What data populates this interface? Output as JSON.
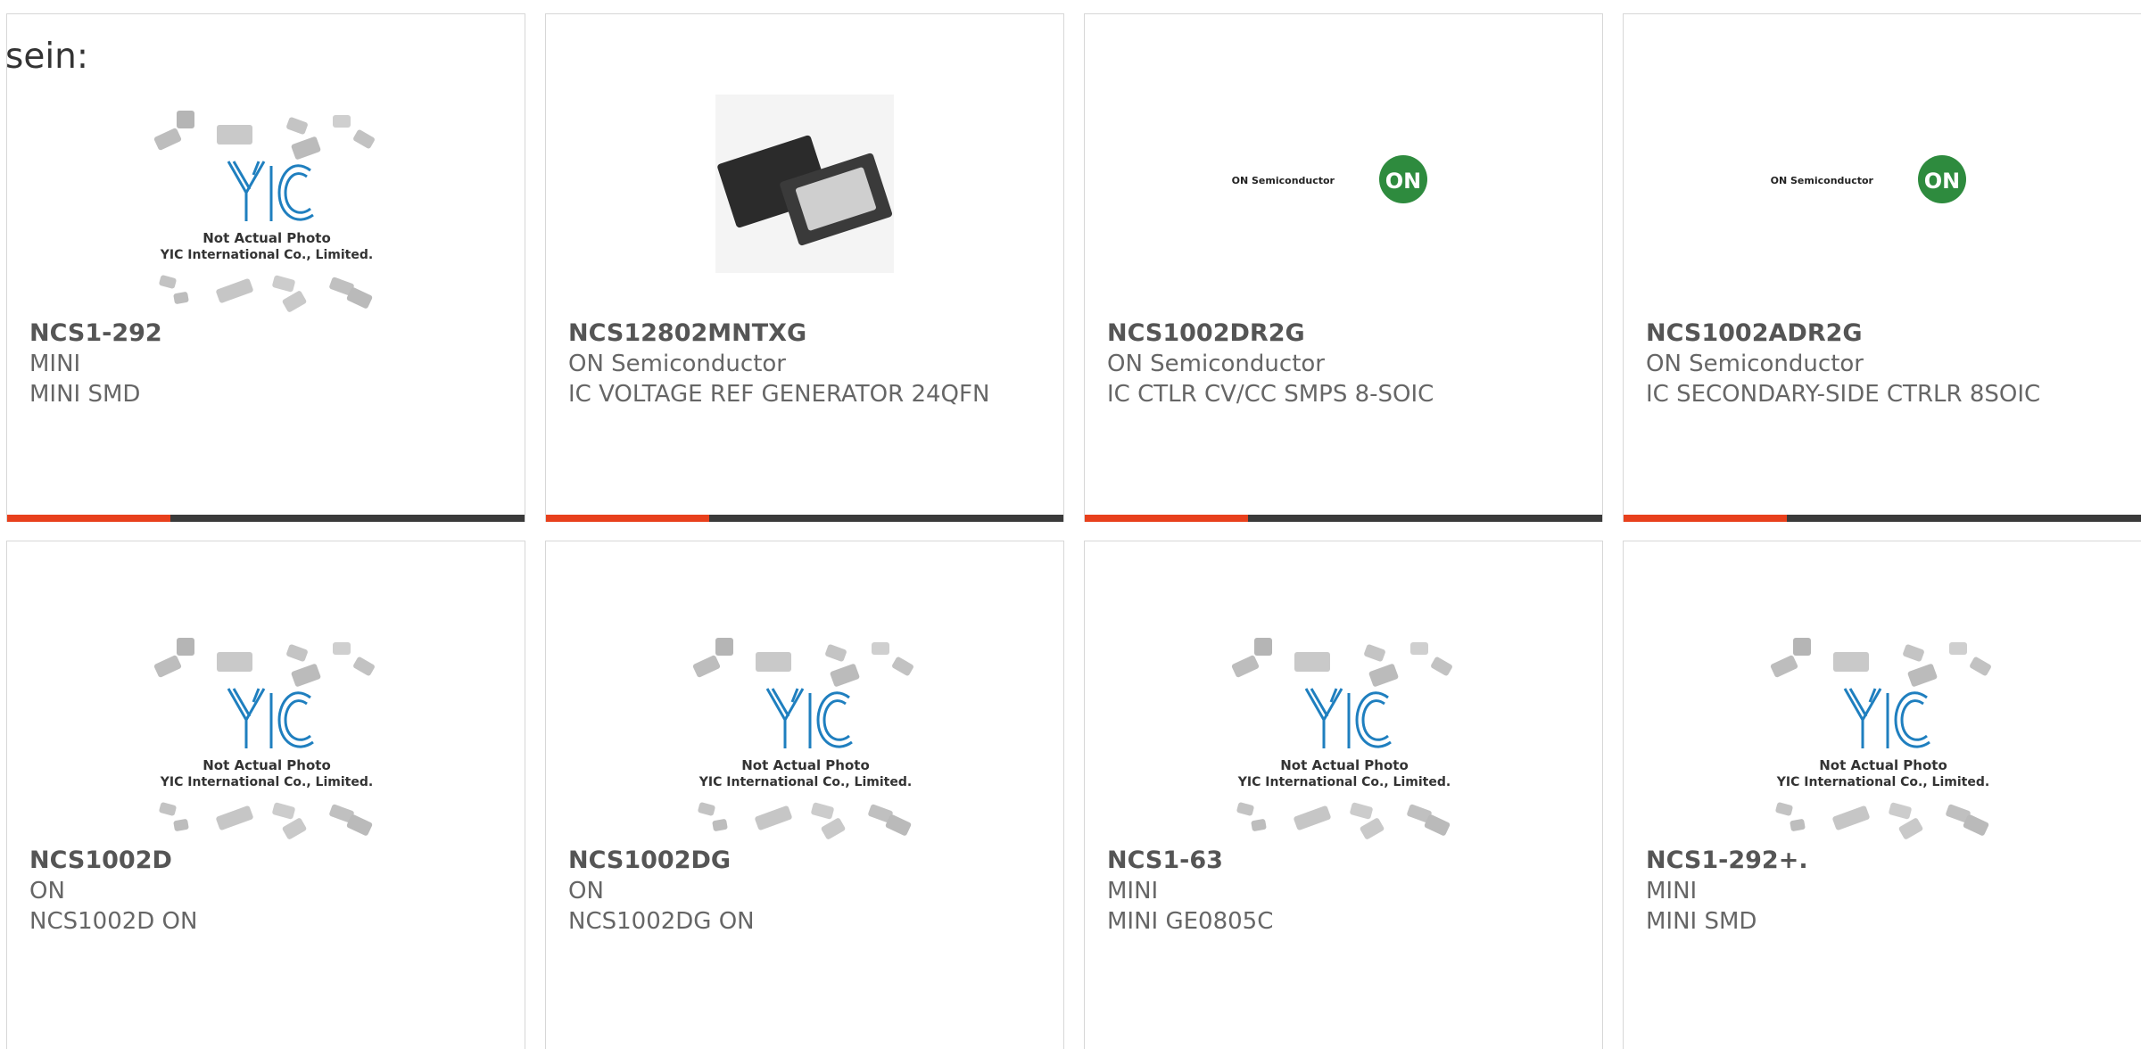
{
  "page": {
    "lead_text": "sein:"
  },
  "placeholder": {
    "line1": "Not Actual Photo",
    "line2": "YIC International Co., Limited."
  },
  "logo": {
    "company_text": "ON Semiconductor",
    "badge_text": "ON"
  },
  "colors": {
    "accent": "#e8401c",
    "bar": "#3a3a3a",
    "yic_blue": "#1f7fbf",
    "on_green": "#2e8b3e"
  },
  "products": [
    {
      "part": "NCS1-292",
      "manufacturer": "MINI",
      "description": "MINI SMD",
      "image": "yic-placeholder"
    },
    {
      "part": "NCS12802MNTXG",
      "manufacturer": "ON Semiconductor",
      "description": "IC VOLTAGE REF GENERATOR 24QFN",
      "image": "qfn-chip-photo"
    },
    {
      "part": "NCS1002DR2G",
      "manufacturer": "ON Semiconductor",
      "description": "IC CTLR CV/CC SMPS 8-SOIC",
      "image": "on-semiconductor-logo"
    },
    {
      "part": "NCS1002ADR2G",
      "manufacturer": "ON Semiconductor",
      "description": "IC SECONDARY-SIDE CTRLR 8SOIC",
      "image": "on-semiconductor-logo"
    },
    {
      "part": "NCS1002D",
      "manufacturer": "ON",
      "description": "NCS1002D ON",
      "image": "yic-placeholder"
    },
    {
      "part": "NCS1002DG",
      "manufacturer": "ON",
      "description": "NCS1002DG ON",
      "image": "yic-placeholder"
    },
    {
      "part": "NCS1-63",
      "manufacturer": "MINI",
      "description": "MINI GE0805C",
      "image": "yic-placeholder"
    },
    {
      "part": "NCS1-292+.",
      "manufacturer": "MINI",
      "description": "MINI SMD",
      "image": "yic-placeholder"
    }
  ]
}
